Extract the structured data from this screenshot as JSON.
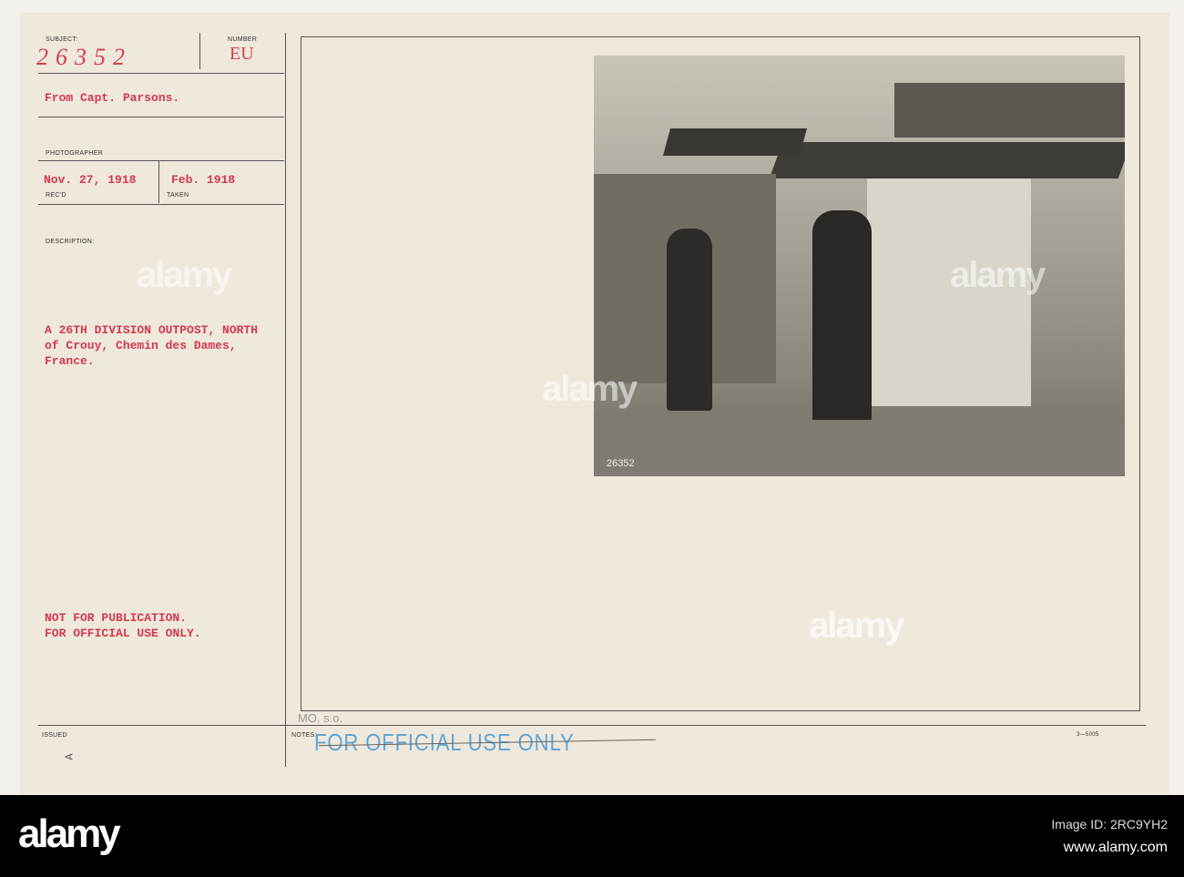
{
  "card": {
    "subject_label": "SUBJECT:",
    "subject_number": "26352",
    "number_label": "NUMBER",
    "number_value": "EU",
    "from": "From Capt. Parsons.",
    "photographer_label": "PHOTOGRAPHER",
    "received_date": "Nov. 27, 1918",
    "received_label": "REC'D",
    "taken_date": "Feb.  1918",
    "taken_label": "TAKEN",
    "description_label": "DESCRIPTION:",
    "description_lines": [
      "A 26TH DIVISION OUTPOST, NORTH",
      "of Crouy, Chemin des Dames,",
      "France."
    ],
    "restriction_lines": [
      "NOT FOR PUBLICATION.",
      "FOR OFFICIAL USE ONLY."
    ],
    "issued_label": "ISSUED",
    "issued_mark": "A",
    "notes_label": "NOTES:",
    "notes_handwritten": "MO. s.o.",
    "stamp": "FOR OFFICIAL USE ONLY",
    "form_number": "3—5005",
    "photo_number": "26352"
  },
  "watermark": "alamy",
  "footer": {
    "logo": "alamy",
    "image_id": "Image ID: 2RC9YH2",
    "url": "www.alamy.com"
  }
}
